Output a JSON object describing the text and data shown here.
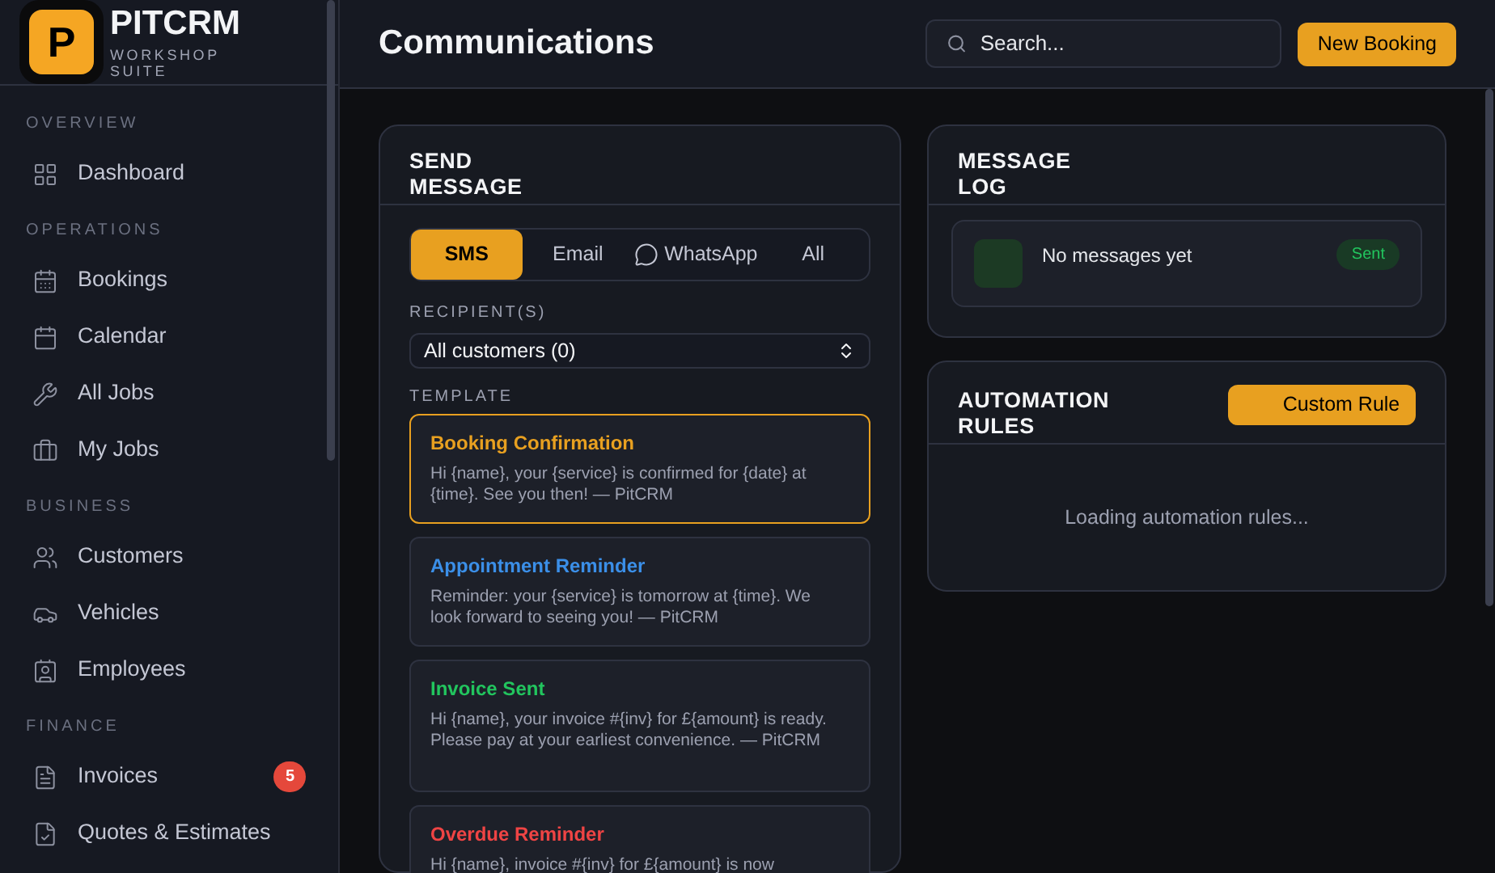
{
  "brand": {
    "logo_letter": "P",
    "name": "PITCRM",
    "tagline": "WORKSHOP SUITE"
  },
  "sidebar": {
    "sections": [
      {
        "title": "OVERVIEW",
        "items": [
          {
            "label": "Dashboard"
          }
        ]
      },
      {
        "title": "OPERATIONS",
        "items": [
          {
            "label": "Bookings"
          },
          {
            "label": "Calendar"
          },
          {
            "label": "All Jobs"
          },
          {
            "label": "My Jobs"
          }
        ]
      },
      {
        "title": "BUSINESS",
        "items": [
          {
            "label": "Customers"
          },
          {
            "label": "Vehicles"
          },
          {
            "label": "Employees"
          }
        ]
      },
      {
        "title": "FINANCE",
        "items": [
          {
            "label": "Invoices",
            "badge": "5"
          },
          {
            "label": "Quotes & Estimates"
          }
        ]
      }
    ]
  },
  "header": {
    "title": "Communications",
    "search": {
      "placeholder": "Search..."
    },
    "primary_button": "New Booking"
  },
  "send_message": {
    "title": "SEND MESSAGE",
    "channels": [
      {
        "label": "SMS",
        "selected": true
      },
      {
        "label": "Email",
        "selected": false
      },
      {
        "label": "WhatsApp",
        "selected": false
      },
      {
        "label": "All",
        "selected": false
      }
    ],
    "recipient_label": "RECIPIENT(S)",
    "recipient_value": "All customers (0)",
    "template_label": "TEMPLATE",
    "templates": [
      {
        "name": "Booking Confirmation",
        "color": "#e8a020",
        "selected": true,
        "body": "Hi {name}, your {service} is confirmed for {date} at {time}. See you then! — PitCRM"
      },
      {
        "name": "Appointment Reminder",
        "color": "#3b8fe8",
        "selected": false,
        "body": "Reminder: your {service} is tomorrow at {time}. We look forward to seeing you! — PitCRM"
      },
      {
        "name": "Invoice Sent",
        "color": "#22c55e",
        "selected": false,
        "body": "Hi {name}, your invoice #{inv} for £{amount} is ready. Please pay at your earliest convenience. — PitCRM"
      },
      {
        "name": "Overdue Reminder",
        "color": "#ef4444",
        "selected": false,
        "body": "Hi {name}, invoice #{inv} for £{amount} is now"
      }
    ]
  },
  "message_log": {
    "title": "MESSAGE LOG",
    "entries": [
      {
        "text": "No messages yet",
        "status": "Sent"
      }
    ]
  },
  "automation": {
    "title": "AUTOMATION RULES",
    "button": "Custom Rule",
    "loading": "Loading automation rules..."
  }
}
